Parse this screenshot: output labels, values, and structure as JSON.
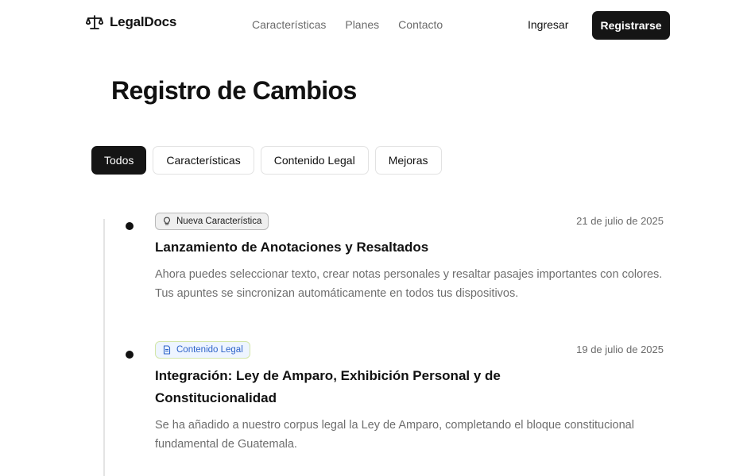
{
  "header": {
    "logo_text": "LegalDocs",
    "nav": [
      "Características",
      "Planes",
      "Contacto"
    ],
    "login_label": "Ingresar",
    "signup_label": "Registrarse"
  },
  "page": {
    "title": "Registro de Cambios"
  },
  "filters": [
    {
      "label": "Todos",
      "active": true
    },
    {
      "label": "Características",
      "active": false
    },
    {
      "label": "Contenido Legal",
      "active": false
    },
    {
      "label": "Mejoras",
      "active": false
    }
  ],
  "entries": [
    {
      "badge": "Nueva Característica",
      "badge_icon": "lightbulb-icon",
      "date": "21 de julio de 2025",
      "title": "Lanzamiento de Anotaciones y Resaltados",
      "description": "Ahora puedes seleccionar texto, crear notas personales y resaltar pasajes importantes con colores. Tus apuntes se sincronizan automáticamente en todos tus dispositivos."
    },
    {
      "badge": "Contenido Legal",
      "badge_icon": "document-icon",
      "date": "19 de julio de 2025",
      "title": "Integración: Ley de Amparo, Exhibición Personal y de Constitucionalidad",
      "description": "Se ha añadido a nuestro corpus legal la Ley de Amparo, completando el bloque constitucional fundamental de Guatemala."
    }
  ],
  "colors": {
    "primary": "#151515",
    "muted_text": "#6e6e6e",
    "legal_badge_text": "#2e63c8"
  }
}
